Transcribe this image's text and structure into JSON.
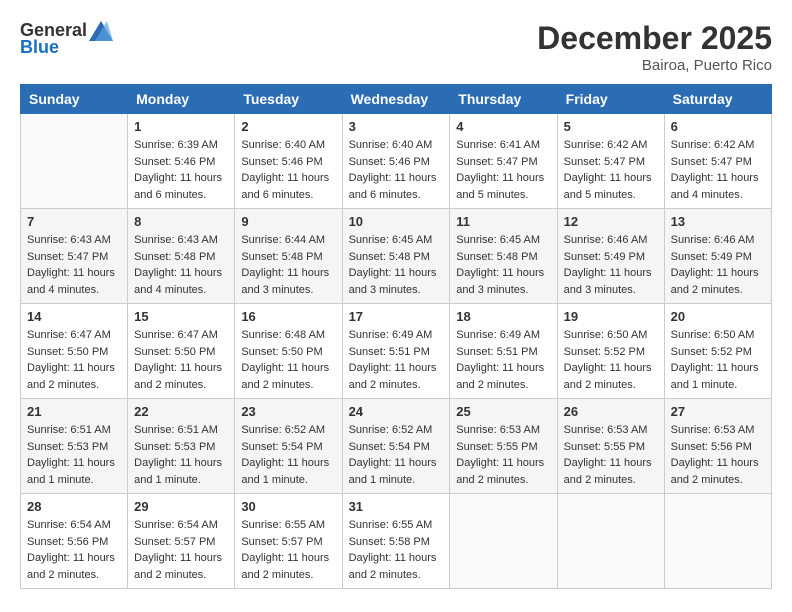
{
  "header": {
    "logo": {
      "text_general": "General",
      "text_blue": "Blue"
    },
    "month_title": "December 2025",
    "location": "Bairoa, Puerto Rico"
  },
  "weekdays": [
    "Sunday",
    "Monday",
    "Tuesday",
    "Wednesday",
    "Thursday",
    "Friday",
    "Saturday"
  ],
  "weeks": [
    [
      {
        "day": "",
        "sunrise": "",
        "sunset": "",
        "daylight": ""
      },
      {
        "day": "1",
        "sunrise": "Sunrise: 6:39 AM",
        "sunset": "Sunset: 5:46 PM",
        "daylight": "Daylight: 11 hours and 6 minutes."
      },
      {
        "day": "2",
        "sunrise": "Sunrise: 6:40 AM",
        "sunset": "Sunset: 5:46 PM",
        "daylight": "Daylight: 11 hours and 6 minutes."
      },
      {
        "day": "3",
        "sunrise": "Sunrise: 6:40 AM",
        "sunset": "Sunset: 5:46 PM",
        "daylight": "Daylight: 11 hours and 6 minutes."
      },
      {
        "day": "4",
        "sunrise": "Sunrise: 6:41 AM",
        "sunset": "Sunset: 5:47 PM",
        "daylight": "Daylight: 11 hours and 5 minutes."
      },
      {
        "day": "5",
        "sunrise": "Sunrise: 6:42 AM",
        "sunset": "Sunset: 5:47 PM",
        "daylight": "Daylight: 11 hours and 5 minutes."
      },
      {
        "day": "6",
        "sunrise": "Sunrise: 6:42 AM",
        "sunset": "Sunset: 5:47 PM",
        "daylight": "Daylight: 11 hours and 4 minutes."
      }
    ],
    [
      {
        "day": "7",
        "sunrise": "Sunrise: 6:43 AM",
        "sunset": "Sunset: 5:47 PM",
        "daylight": "Daylight: 11 hours and 4 minutes."
      },
      {
        "day": "8",
        "sunrise": "Sunrise: 6:43 AM",
        "sunset": "Sunset: 5:48 PM",
        "daylight": "Daylight: 11 hours and 4 minutes."
      },
      {
        "day": "9",
        "sunrise": "Sunrise: 6:44 AM",
        "sunset": "Sunset: 5:48 PM",
        "daylight": "Daylight: 11 hours and 3 minutes."
      },
      {
        "day": "10",
        "sunrise": "Sunrise: 6:45 AM",
        "sunset": "Sunset: 5:48 PM",
        "daylight": "Daylight: 11 hours and 3 minutes."
      },
      {
        "day": "11",
        "sunrise": "Sunrise: 6:45 AM",
        "sunset": "Sunset: 5:48 PM",
        "daylight": "Daylight: 11 hours and 3 minutes."
      },
      {
        "day": "12",
        "sunrise": "Sunrise: 6:46 AM",
        "sunset": "Sunset: 5:49 PM",
        "daylight": "Daylight: 11 hours and 3 minutes."
      },
      {
        "day": "13",
        "sunrise": "Sunrise: 6:46 AM",
        "sunset": "Sunset: 5:49 PM",
        "daylight": "Daylight: 11 hours and 2 minutes."
      }
    ],
    [
      {
        "day": "14",
        "sunrise": "Sunrise: 6:47 AM",
        "sunset": "Sunset: 5:50 PM",
        "daylight": "Daylight: 11 hours and 2 minutes."
      },
      {
        "day": "15",
        "sunrise": "Sunrise: 6:47 AM",
        "sunset": "Sunset: 5:50 PM",
        "daylight": "Daylight: 11 hours and 2 minutes."
      },
      {
        "day": "16",
        "sunrise": "Sunrise: 6:48 AM",
        "sunset": "Sunset: 5:50 PM",
        "daylight": "Daylight: 11 hours and 2 minutes."
      },
      {
        "day": "17",
        "sunrise": "Sunrise: 6:49 AM",
        "sunset": "Sunset: 5:51 PM",
        "daylight": "Daylight: 11 hours and 2 minutes."
      },
      {
        "day": "18",
        "sunrise": "Sunrise: 6:49 AM",
        "sunset": "Sunset: 5:51 PM",
        "daylight": "Daylight: 11 hours and 2 minutes."
      },
      {
        "day": "19",
        "sunrise": "Sunrise: 6:50 AM",
        "sunset": "Sunset: 5:52 PM",
        "daylight": "Daylight: 11 hours and 2 minutes."
      },
      {
        "day": "20",
        "sunrise": "Sunrise: 6:50 AM",
        "sunset": "Sunset: 5:52 PM",
        "daylight": "Daylight: 11 hours and 1 minute."
      }
    ],
    [
      {
        "day": "21",
        "sunrise": "Sunrise: 6:51 AM",
        "sunset": "Sunset: 5:53 PM",
        "daylight": "Daylight: 11 hours and 1 minute."
      },
      {
        "day": "22",
        "sunrise": "Sunrise: 6:51 AM",
        "sunset": "Sunset: 5:53 PM",
        "daylight": "Daylight: 11 hours and 1 minute."
      },
      {
        "day": "23",
        "sunrise": "Sunrise: 6:52 AM",
        "sunset": "Sunset: 5:54 PM",
        "daylight": "Daylight: 11 hours and 1 minute."
      },
      {
        "day": "24",
        "sunrise": "Sunrise: 6:52 AM",
        "sunset": "Sunset: 5:54 PM",
        "daylight": "Daylight: 11 hours and 1 minute."
      },
      {
        "day": "25",
        "sunrise": "Sunrise: 6:53 AM",
        "sunset": "Sunset: 5:55 PM",
        "daylight": "Daylight: 11 hours and 2 minutes."
      },
      {
        "day": "26",
        "sunrise": "Sunrise: 6:53 AM",
        "sunset": "Sunset: 5:55 PM",
        "daylight": "Daylight: 11 hours and 2 minutes."
      },
      {
        "day": "27",
        "sunrise": "Sunrise: 6:53 AM",
        "sunset": "Sunset: 5:56 PM",
        "daylight": "Daylight: 11 hours and 2 minutes."
      }
    ],
    [
      {
        "day": "28",
        "sunrise": "Sunrise: 6:54 AM",
        "sunset": "Sunset: 5:56 PM",
        "daylight": "Daylight: 11 hours and 2 minutes."
      },
      {
        "day": "29",
        "sunrise": "Sunrise: 6:54 AM",
        "sunset": "Sunset: 5:57 PM",
        "daylight": "Daylight: 11 hours and 2 minutes."
      },
      {
        "day": "30",
        "sunrise": "Sunrise: 6:55 AM",
        "sunset": "Sunset: 5:57 PM",
        "daylight": "Daylight: 11 hours and 2 minutes."
      },
      {
        "day": "31",
        "sunrise": "Sunrise: 6:55 AM",
        "sunset": "Sunset: 5:58 PM",
        "daylight": "Daylight: 11 hours and 2 minutes."
      },
      {
        "day": "",
        "sunrise": "",
        "sunset": "",
        "daylight": ""
      },
      {
        "day": "",
        "sunrise": "",
        "sunset": "",
        "daylight": ""
      },
      {
        "day": "",
        "sunrise": "",
        "sunset": "",
        "daylight": ""
      }
    ]
  ]
}
